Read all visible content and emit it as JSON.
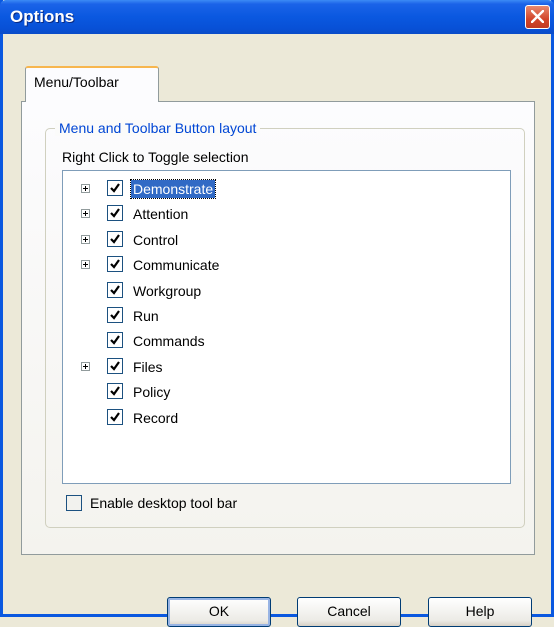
{
  "window": {
    "title": "Options"
  },
  "tabs": [
    {
      "label": "Menu/Toolbar",
      "selected": true
    }
  ],
  "group": {
    "label": "Menu and Toolbar Button layout",
    "hint": "Right Click to Toggle selection"
  },
  "tree": {
    "items": [
      {
        "label": "Demonstrate",
        "checked": true,
        "expandable": true,
        "selected": true
      },
      {
        "label": "Attention",
        "checked": true,
        "expandable": true,
        "selected": false
      },
      {
        "label": "Control",
        "checked": true,
        "expandable": true,
        "selected": false
      },
      {
        "label": "Communicate",
        "checked": true,
        "expandable": true,
        "selected": false
      },
      {
        "label": "Workgroup",
        "checked": true,
        "expandable": false,
        "selected": false
      },
      {
        "label": "Run",
        "checked": true,
        "expandable": false,
        "selected": false
      },
      {
        "label": "Commands",
        "checked": true,
        "expandable": false,
        "selected": false
      },
      {
        "label": "Files",
        "checked": true,
        "expandable": true,
        "selected": false
      },
      {
        "label": "Policy",
        "checked": true,
        "expandable": false,
        "selected": false
      },
      {
        "label": "Record",
        "checked": true,
        "expandable": false,
        "selected": false
      }
    ]
  },
  "desktop_toolbar": {
    "label": "Enable desktop tool bar",
    "checked": false
  },
  "buttons": {
    "ok": "OK",
    "cancel": "Cancel",
    "help": "Help"
  },
  "colors": {
    "title_bar": "#0a58e0",
    "group_label": "#0046d5",
    "selection": "#316ac5",
    "close_button": "#d2452a"
  }
}
